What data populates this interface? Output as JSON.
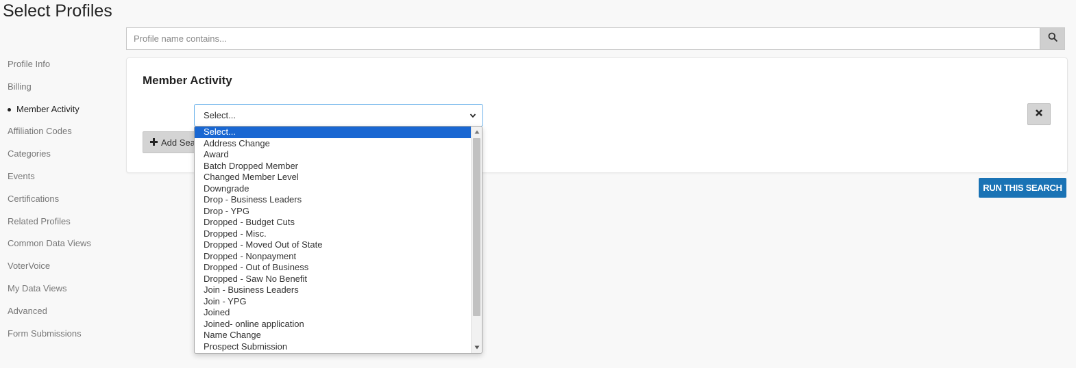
{
  "page": {
    "title": "Select Profiles"
  },
  "search": {
    "placeholder": "Profile name contains...",
    "value": ""
  },
  "sidebar": {
    "items": [
      {
        "label": "Profile Info",
        "active": false
      },
      {
        "label": "Billing",
        "active": false
      },
      {
        "label": "Member Activity",
        "active": true
      },
      {
        "label": "Affiliation Codes",
        "active": false
      },
      {
        "label": "Categories",
        "active": false
      },
      {
        "label": "Events",
        "active": false
      },
      {
        "label": "Certifications",
        "active": false
      },
      {
        "label": "Related Profiles",
        "active": false
      },
      {
        "label": "Common Data Views",
        "active": false
      },
      {
        "label": "VoterVoice",
        "active": false
      },
      {
        "label": "My Data Views",
        "active": false
      },
      {
        "label": "Advanced",
        "active": false
      },
      {
        "label": "Form Submissions",
        "active": false
      }
    ]
  },
  "panel": {
    "title": "Member Activity",
    "select": {
      "value": "Select..."
    },
    "add_button": {
      "label": "Add Sear"
    }
  },
  "run_button": {
    "label": "RUN THIS SEARCH"
  },
  "dropdown": {
    "selected_index": 0,
    "options": [
      "Select...",
      "Address Change",
      "Award",
      "Batch Dropped Member",
      "Changed Member Level",
      "Downgrade",
      "Drop - Business Leaders",
      "Drop - YPG",
      "Dropped - Budget Cuts",
      "Dropped - Misc.",
      "Dropped - Moved Out of State",
      "Dropped - Nonpayment",
      "Dropped - Out of Business",
      "Dropped - Saw No Benefit",
      "Join - Business Leaders",
      "Join - YPG",
      "Joined",
      "Joined- online application",
      "Name Change",
      "Prospect Submission"
    ]
  },
  "colors": {
    "accent": "#1a73b5",
    "selected_option": "#1967d2",
    "focus_border": "#66afe9"
  },
  "icons": {
    "search": "search-icon",
    "remove": "close-icon",
    "add": "plus-icon",
    "select_chevron": "chevron-down-icon"
  }
}
